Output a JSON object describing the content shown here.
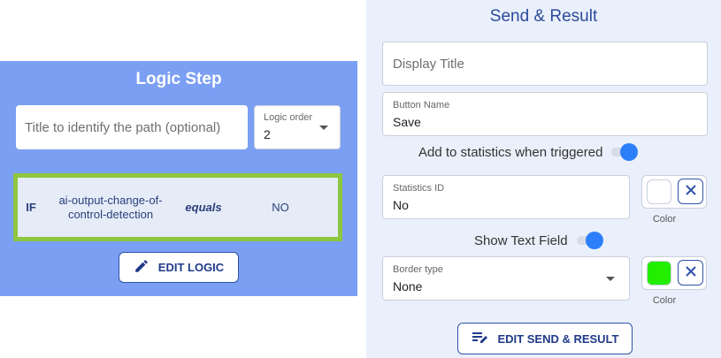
{
  "logic_step": {
    "title": "Logic Step",
    "title_input_placeholder": "Title to identify the path (optional)",
    "logic_order_label": "Logic order",
    "logic_order_value": "2",
    "condition": {
      "keyword": "IF",
      "variable": "ai-output-change-of-control-detection",
      "operator": "equals",
      "value": "NO"
    },
    "edit_logic_label": "EDIT LOGIC"
  },
  "send_result": {
    "title": "Send & Result",
    "display_title_placeholder": "Display Title",
    "button_name_label": "Button Name",
    "button_name_value": "Save",
    "add_to_statistics_label": "Add to statistics when triggered",
    "add_to_statistics_on": true,
    "statistics_id_label": "Statistics ID",
    "statistics_id_value": "No",
    "statistics_color": "#ffffff",
    "color_label": "Color",
    "show_text_field_label": "Show Text Field",
    "show_text_field_on": true,
    "border_type_label": "Border type",
    "border_type_value": "None",
    "border_color": "#22ee00",
    "clear_icon": "close-icon",
    "edit_send_label": "EDIT SEND & RESULT"
  },
  "colors": {
    "logic_panel_bg": "#7b9ff3",
    "send_panel_bg": "#eaf0fb",
    "accent": "#2e52a8",
    "condition_highlight": "#8dc63f",
    "toggle_on": "#2d7ff9"
  }
}
